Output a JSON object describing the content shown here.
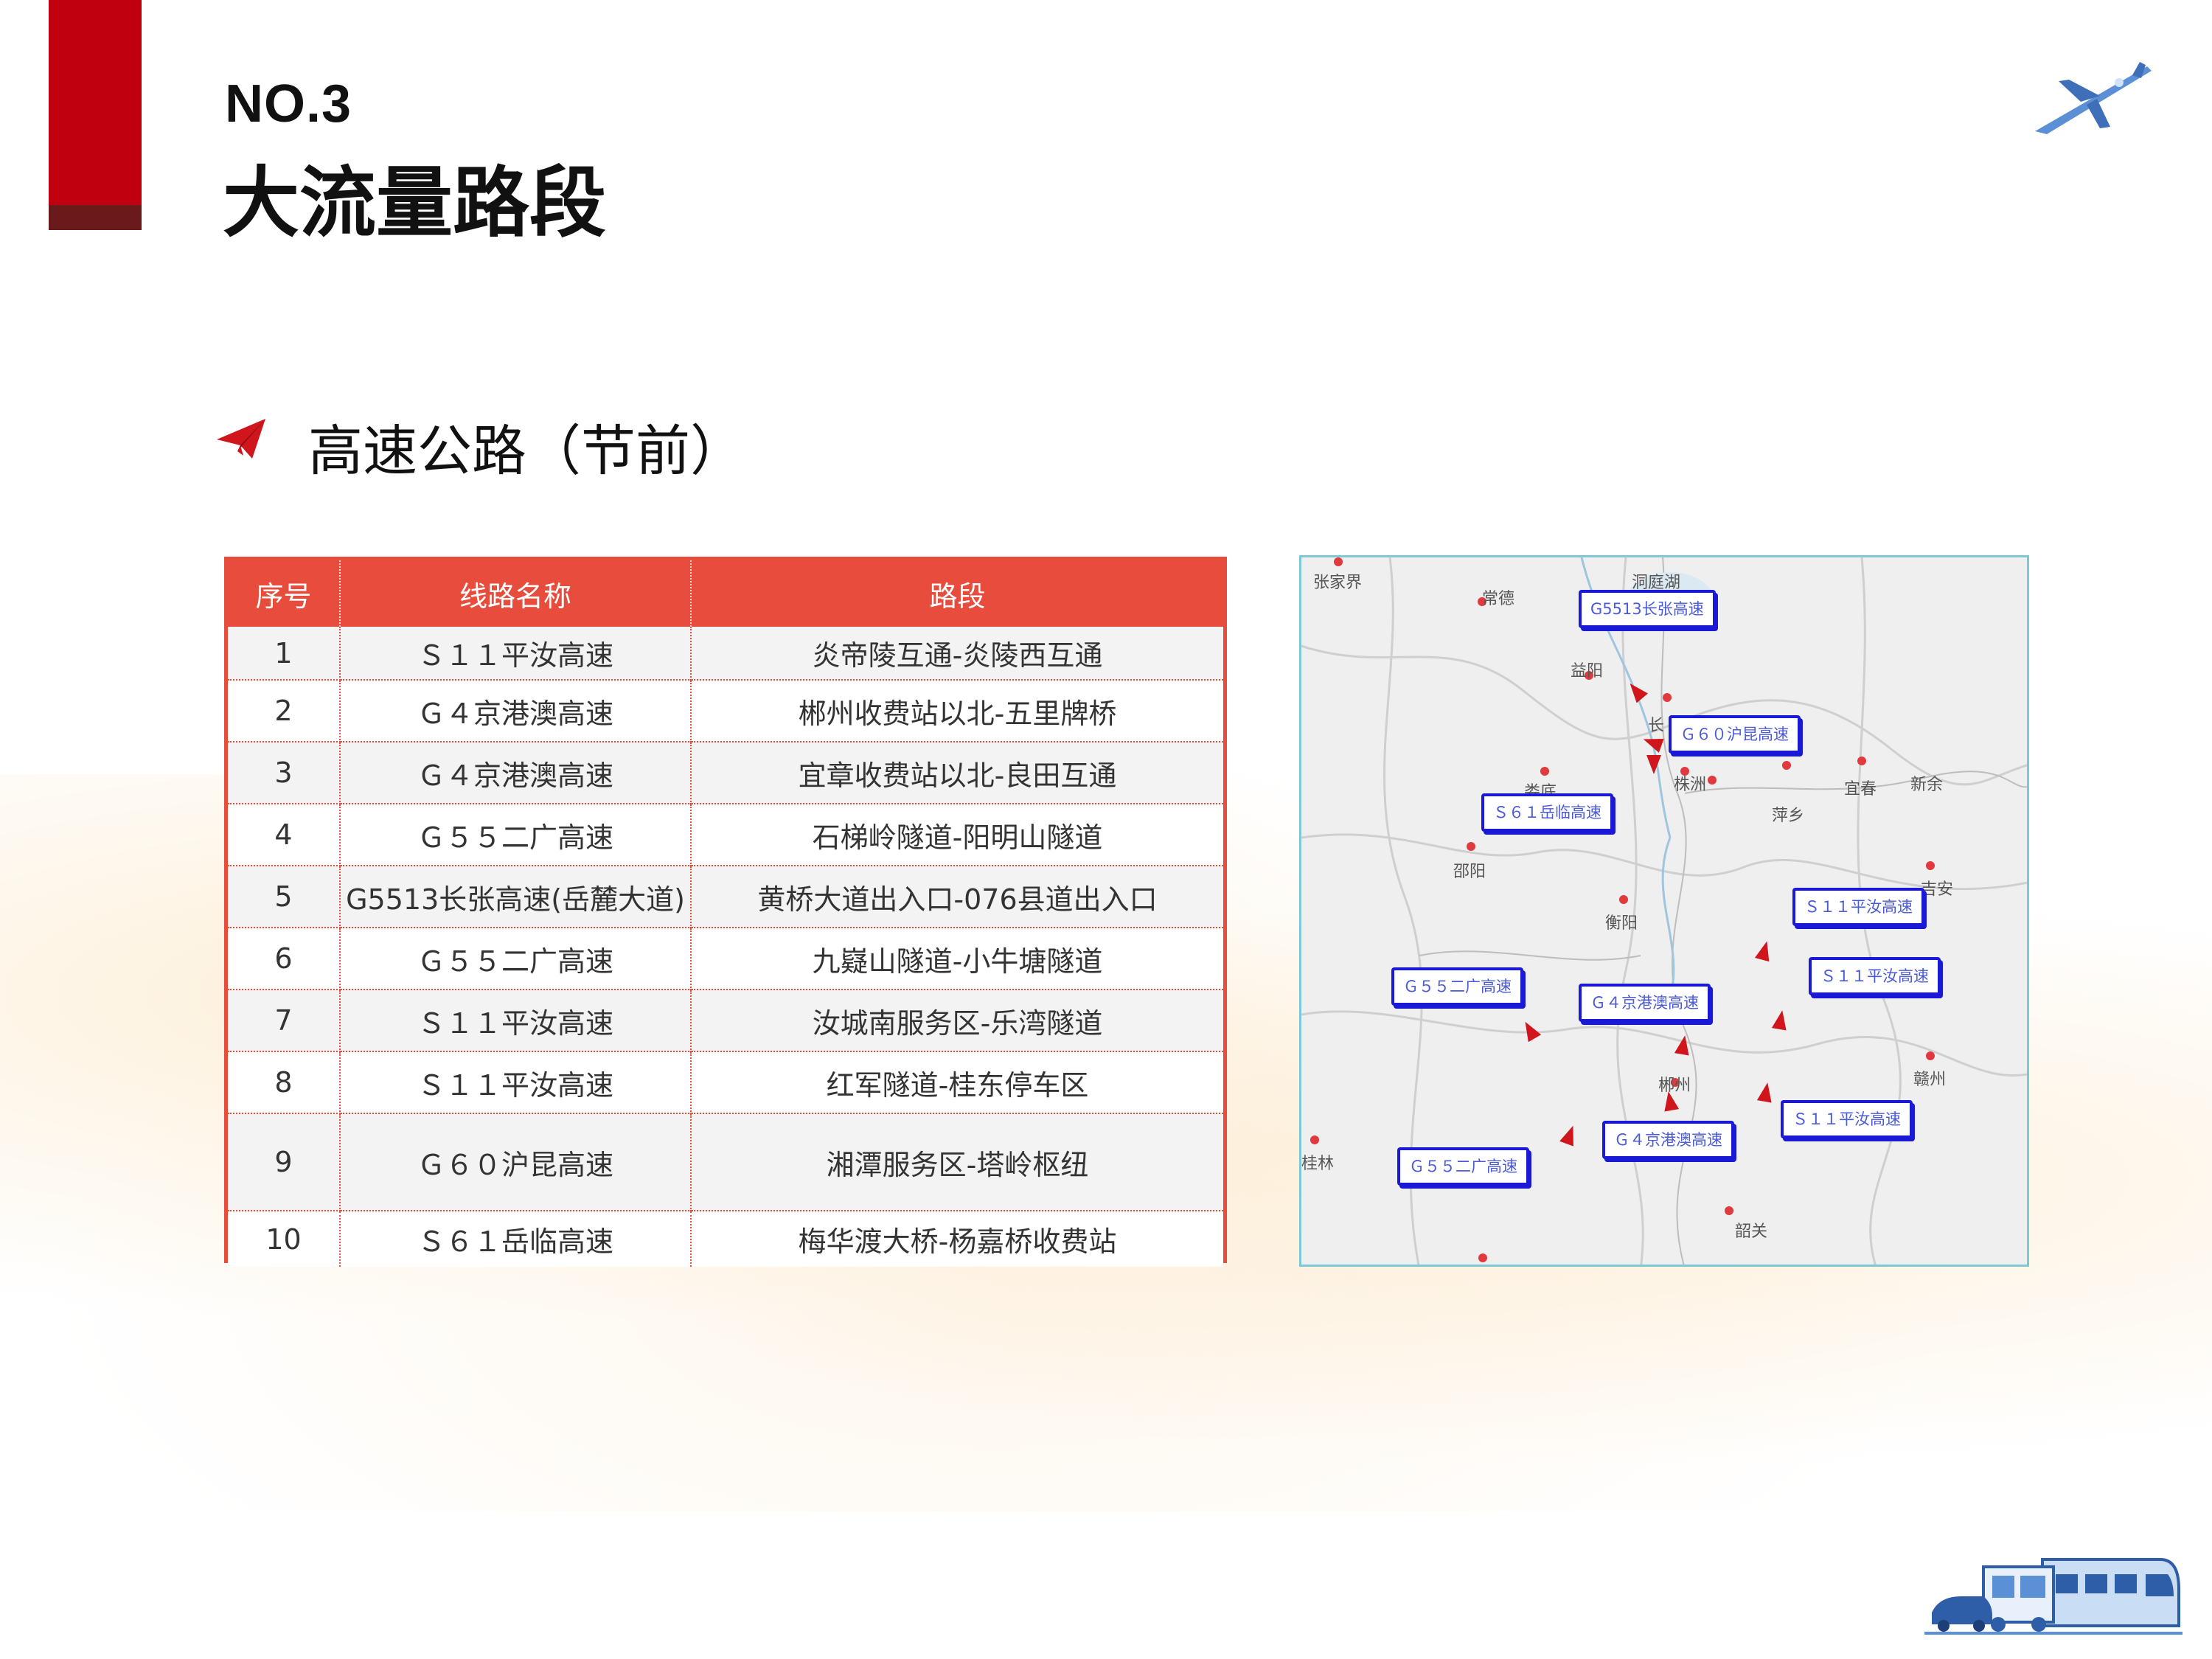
{
  "header": {
    "number": "NO.3",
    "title": "大流量路段"
  },
  "section": {
    "title": "高速公路（节前）"
  },
  "table": {
    "columns": [
      "序号",
      "线路名称",
      "路段"
    ],
    "rows": [
      [
        "1",
        "Ｓ１１平汝高速",
        "炎帝陵互通-炎陵西互通"
      ],
      [
        "2",
        "Ｇ４京港澳高速",
        "郴州收费站以北-五里牌桥"
      ],
      [
        "3",
        "Ｇ４京港澳高速",
        "宜章收费站以北-良田互通"
      ],
      [
        "4",
        "Ｇ５５二广高速",
        "石梯岭隧道-阳明山隧道"
      ],
      [
        "5",
        "G5513长张高速(岳麓大道)",
        "黄桥大道出入口-076县道出入口"
      ],
      [
        "6",
        "Ｇ５５二广高速",
        "九嶷山隧道-小牛塘隧道"
      ],
      [
        "7",
        "Ｓ１１平汝高速",
        "汝城南服务区-乐湾隧道"
      ],
      [
        "8",
        "Ｓ１１平汝高速",
        "红军隧道-桂东停车区"
      ],
      [
        "9",
        "Ｇ６０沪昆高速",
        "湘潭服务区-塔岭枢纽"
      ],
      [
        "10",
        "Ｓ６１岳临高速",
        "梅华渡大桥-杨嘉桥收费站"
      ]
    ]
  },
  "map": {
    "cities": [
      "张家界",
      "常德",
      "洞庭湖",
      "益阳",
      "长",
      "株洲",
      "宜春",
      "新余",
      "萍乡",
      "娄底",
      "邵阳",
      "衡阳",
      "吉安",
      "郴州",
      "赣州",
      "韶关",
      "桂林"
    ],
    "road_labels": [
      "G5513长张高速",
      "Ｇ６０沪昆高速",
      "Ｓ６１岳临高速",
      "Ｓ１１平汝高速",
      "Ｓ１１平汝高速",
      "Ｇ５５二广高速",
      "Ｇ４京港澳高速",
      "Ｇ４京港澳高速",
      "Ｓ１１平汝高速",
      "Ｇ５５二广高速"
    ]
  },
  "colors": {
    "brand_red": "#c1000f",
    "table_red": "#e74c3c",
    "label_blue": "#1a1ad6"
  },
  "icons": {
    "plane": "airplane-icon",
    "section": "paper-plane-icon",
    "transport": "train-bus-car-icon"
  }
}
